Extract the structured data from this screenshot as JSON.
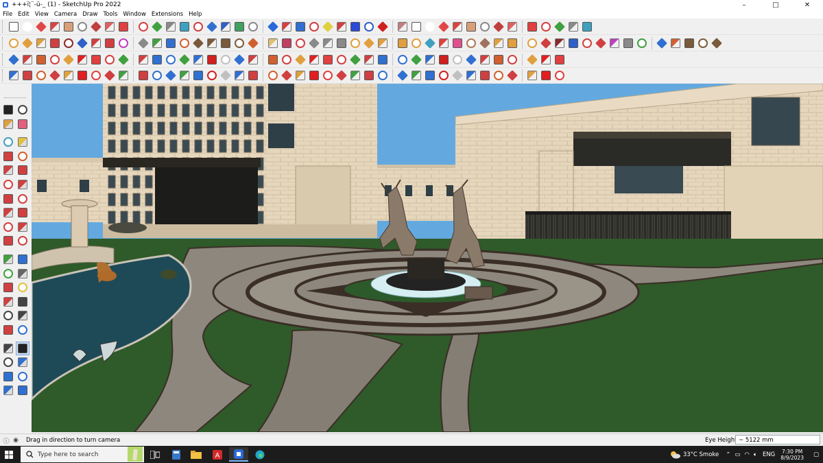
{
  "window": {
    "title": "+++ï¦¨-ü-_ (1) - SketchUp Pro 2022",
    "minimize": "–",
    "maximize": "□",
    "close": "✕"
  },
  "menu": [
    "File",
    "Edit",
    "View",
    "Camera",
    "Draw",
    "Tools",
    "Window",
    "Extensions",
    "Help"
  ],
  "toolbar_rows": [
    {
      "count": 42,
      "colors": [
        "#ffffff",
        "#ffffff",
        "#e04848",
        "#d84444",
        "#d8a078",
        "#8a8a8a",
        "#c04040",
        "#e06060",
        "#e04040",
        "#d84040",
        "#40a040",
        "#8a8a8a",
        "#40a0c0",
        "#d04040",
        "#3070d0",
        "#3060c8",
        "#40a060",
        "#8a8a8a",
        "#2a6ad8",
        "#d84040",
        "#3070d0",
        "#d04040",
        "#e0d040",
        "#d04040",
        "#2a4ad8",
        "#3060c8",
        "#d02020",
        "#c08080"
      ]
    },
    {
      "count": 48,
      "colors": [
        "#e0a040",
        "#e0a040",
        "#e0a040",
        "#d04040",
        "#8a2a2a",
        "#3060c8",
        "#d04040",
        "#d04040",
        "#c040c0",
        "#8a8a8a",
        "#40a040",
        "#3070d0",
        "#d06030",
        "#7a5a3a",
        "#7a5a3a",
        "#7a5a3a",
        "#7a5a3a",
        "#d06030",
        "#e0c070",
        "#c04060",
        "#d04040",
        "#8a8a8a",
        "#8a8a8a",
        "#8a8a8a",
        "#e0a040",
        "#e0a040",
        "#e0a040",
        "#e0a040",
        "#e0a040",
        "#40a0c0",
        "#e04040",
        "#e05090",
        "#b0785a",
        "#a07060"
      ]
    },
    {
      "count": 60,
      "colors": [
        "#3070d0",
        "#d04040",
        "#d06030",
        "#d04040",
        "#e0a040",
        "#e02020",
        "#e04040",
        "#d04040",
        "#40a040",
        "#d04040",
        "#3070d0",
        "#3070d0",
        "#40a040",
        "#3070d0",
        "#d02020",
        "#c0c0c0"
      ]
    }
  ],
  "left_toolbar": [
    {
      "name": "select-icon",
      "color": "#222222"
    },
    {
      "name": "orbit-icon",
      "color": "#444444"
    },
    {
      "name": "paint-bucket-icon",
      "color": "#e0a040"
    },
    {
      "name": "eraser-icon",
      "color": "#e06080"
    },
    {
      "name": "tag-icon",
      "color": "#40a0c0"
    },
    {
      "name": "lasso-icon",
      "color": "#e0c040"
    },
    {
      "name": "pencil-icon",
      "color": "#d04040"
    },
    {
      "name": "freehand-icon",
      "color": "#d06030"
    },
    {
      "name": "rectangle-icon",
      "color": "#d04040"
    },
    {
      "name": "rotated-rect-icon",
      "color": "#d04040"
    },
    {
      "name": "circle-icon",
      "color": "#d04040"
    },
    {
      "name": "polygon-icon",
      "color": "#d04040"
    },
    {
      "name": "arc-icon",
      "color": "#d04040"
    },
    {
      "name": "pie-icon",
      "color": "#d04040"
    },
    {
      "name": "move-icon",
      "color": "#d04040"
    },
    {
      "name": "push-pull-icon",
      "color": "#d04040"
    },
    {
      "name": "rotate-icon",
      "color": "#d04040"
    },
    {
      "name": "follow-me-icon",
      "color": "#d04040"
    },
    {
      "name": "scale-icon",
      "color": "#d04040"
    },
    {
      "name": "offset-icon",
      "color": "#d04040"
    },
    {
      "name": "tape-measure-icon",
      "color": "#40a040"
    },
    {
      "name": "dimension-icon",
      "color": "#3070d0"
    },
    {
      "name": "protractor-icon",
      "color": "#40a040"
    },
    {
      "name": "text-icon",
      "color": "#666666"
    },
    {
      "name": "axes-icon",
      "color": "#d04040"
    },
    {
      "name": "3d-text-icon",
      "color": "#e0c040"
    },
    {
      "name": "orbit-view-icon",
      "color": "#d04040"
    },
    {
      "name": "pan-icon",
      "color": "#444444"
    },
    {
      "name": "zoom-icon",
      "color": "#444444"
    },
    {
      "name": "zoom-window-icon",
      "color": "#444444"
    },
    {
      "name": "zoom-extents-icon",
      "color": "#d04040"
    },
    {
      "name": "previous-view-icon",
      "color": "#3070d0"
    },
    {
      "name": "position-camera-icon",
      "color": "#444444"
    },
    {
      "name": "look-around-icon",
      "color": "#222222"
    },
    {
      "name": "walk-icon",
      "color": "#444444"
    },
    {
      "name": "section-plane-icon",
      "color": "#3070d0"
    },
    {
      "name": "warehouse-icon",
      "color": "#3070d0"
    },
    {
      "name": "extension-icon",
      "color": "#3070d0"
    },
    {
      "name": "layers-icon",
      "color": "#3070d0"
    },
    {
      "name": "styles-icon",
      "color": "#3070d0"
    }
  ],
  "status": {
    "message": "Drag in direction to turn camera",
    "vcb_label": "Eye Height",
    "vcb_value": "~ 5122 mm"
  },
  "taskbar": {
    "search_placeholder": "Type here to search",
    "weather": "33°C  Smoke",
    "language": "ENG",
    "time": "7:30 PM",
    "date": "8/9/2023"
  },
  "colors": {
    "sky": "#63a9e0",
    "grass": "#2f5a2a",
    "path": "#8d877d",
    "building": "#e8d8bf",
    "water": "#1e4a58",
    "statue": "#8a7a6a"
  }
}
